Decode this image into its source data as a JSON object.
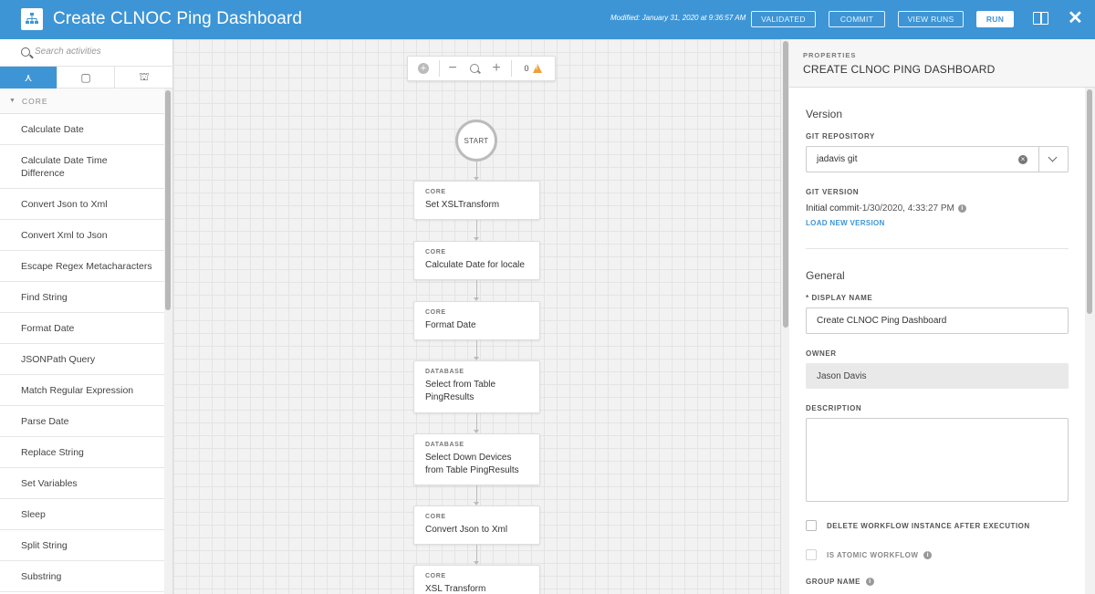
{
  "header": {
    "title": "Create CLNOC Ping Dashboard",
    "modified": "Modified: January 31, 2020 at 9:36:57 AM",
    "buttons": {
      "validated": "VALIDATED",
      "commit": "COMMIT",
      "view_runs": "VIEW RUNS",
      "run": "RUN"
    },
    "close_glyph": "✕"
  },
  "palette": {
    "search_placeholder": "Search activities",
    "tabs": [
      {
        "icon": "activity-icon",
        "glyph": "⋏"
      },
      {
        "icon": "square-icon",
        "glyph": "▢"
      },
      {
        "icon": "hierarchy-icon",
        "glyph": "⛫"
      }
    ],
    "section": "CORE",
    "items": [
      "Calculate Date",
      "Calculate Date Time Difference",
      "Convert Json to Xml",
      "Convert Xml to Json",
      "Escape Regex Metacharacters",
      "Find String",
      "Format Date",
      "JSONPath Query",
      "Match Regular Expression",
      "Parse Date",
      "Replace String",
      "Set Variables",
      "Sleep",
      "Split String",
      "Substring"
    ]
  },
  "canvas": {
    "toolbar": {
      "add": "+",
      "zoom_out": "−",
      "zoom_in": "+",
      "warning_count": "0"
    },
    "start_label": "START",
    "nodes": [
      {
        "category": "CORE",
        "name": "Set XSLTransform"
      },
      {
        "category": "CORE",
        "name": "Calculate Date for locale"
      },
      {
        "category": "CORE",
        "name": "Format Date"
      },
      {
        "category": "DATABASE",
        "name": "Select from Table PingResults"
      },
      {
        "category": "DATABASE",
        "name": "Select Down Devices from Table PingResults"
      },
      {
        "category": "CORE",
        "name": "Convert Json to Xml"
      },
      {
        "category": "CORE",
        "name": "XSL Transform"
      }
    ]
  },
  "properties": {
    "kicker": "PROPERTIES",
    "title": "CREATE CLNOC PING DASHBOARD",
    "version_heading": "Version",
    "git_repo_label": "GIT REPOSITORY",
    "git_repo_value": "jadavis git",
    "git_version_label": "GIT VERSION",
    "git_commit": "Initial commit",
    "git_commit_date": " -1/30/2020, 4:33:27 PM",
    "load_new_version": "LOAD NEW VERSION",
    "general_heading": "General",
    "display_name_label": "* DISPLAY NAME",
    "display_name_value": "Create CLNOC Ping Dashboard",
    "owner_label": "OWNER",
    "owner_value": "Jason Davis",
    "description_label": "DESCRIPTION",
    "description_value": "",
    "delete_instance_label": "DELETE WORKFLOW INSTANCE AFTER EXECUTION",
    "atomic_label": "IS ATOMIC WORKFLOW",
    "group_name_label": "GROUP NAME"
  },
  "colors": {
    "accent": "#3d95d6",
    "warning": "#f0a033"
  }
}
